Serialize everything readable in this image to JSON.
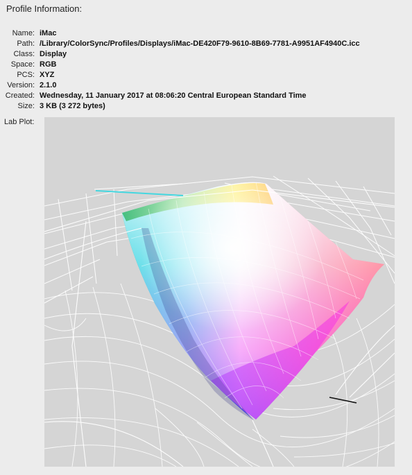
{
  "section": {
    "title": "Profile Information:"
  },
  "info": {
    "rows": [
      {
        "label": "Name:",
        "value": "iMac"
      },
      {
        "label": "Path:",
        "value": "/Library/ColorSync/Profiles/Displays/iMac-DE420F79-9610-8B69-7781-A9951AF4940C.icc"
      },
      {
        "label": "Class:",
        "value": "Display"
      },
      {
        "label": "Space:",
        "value": "RGB"
      },
      {
        "label": "PCS:",
        "value": "XYZ"
      },
      {
        "label": "Version:",
        "value": "2.1.0"
      },
      {
        "label": "Created:",
        "value": "Wednesday, 11 January 2017 at 08:06:20 Central European Standard Time"
      },
      {
        "label": "Size:",
        "value": "3 KB (3 272 bytes)"
      }
    ]
  },
  "lab_plot": {
    "label": "Lab Plot:",
    "toggle_icon": "disclosure-triangle-icon"
  },
  "colors": {
    "background": "#ececec",
    "plot_background": "#d5d5d5",
    "wireframe": "#ffffff"
  }
}
